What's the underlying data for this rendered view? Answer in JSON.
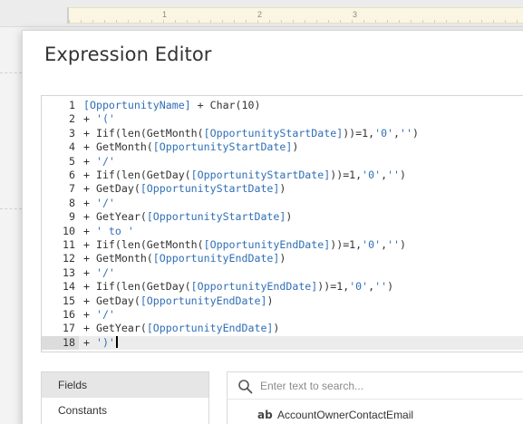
{
  "ruler": {
    "marks": [
      "1",
      "2",
      "3"
    ]
  },
  "dialog": {
    "title": "Expression Editor"
  },
  "editor": {
    "active_line": 18,
    "lines": [
      {
        "num": "1",
        "tokens": [
          {
            "t": "[OpportunityName]",
            "k": "field"
          },
          {
            "t": " + Char(10)",
            "k": "plain"
          }
        ]
      },
      {
        "num": "2",
        "tokens": [
          {
            "t": "+ ",
            "k": "plain"
          },
          {
            "t": "'('",
            "k": "string"
          }
        ]
      },
      {
        "num": "3",
        "tokens": [
          {
            "t": "+ Iif(len(GetMonth(",
            "k": "plain"
          },
          {
            "t": "[OpportunityStartDate]",
            "k": "field"
          },
          {
            "t": "))=1,",
            "k": "plain"
          },
          {
            "t": "'0'",
            "k": "string"
          },
          {
            "t": ",",
            "k": "plain"
          },
          {
            "t": "''",
            "k": "string"
          },
          {
            "t": ")",
            "k": "plain"
          }
        ]
      },
      {
        "num": "4",
        "tokens": [
          {
            "t": "+ GetMonth(",
            "k": "plain"
          },
          {
            "t": "[OpportunityStartDate]",
            "k": "field"
          },
          {
            "t": ")",
            "k": "plain"
          }
        ]
      },
      {
        "num": "5",
        "tokens": [
          {
            "t": "+ ",
            "k": "plain"
          },
          {
            "t": "'/'",
            "k": "string"
          }
        ]
      },
      {
        "num": "6",
        "tokens": [
          {
            "t": "+ Iif(len(GetDay(",
            "k": "plain"
          },
          {
            "t": "[OpportunityStartDate]",
            "k": "field"
          },
          {
            "t": "))=1,",
            "k": "plain"
          },
          {
            "t": "'0'",
            "k": "string"
          },
          {
            "t": ",",
            "k": "plain"
          },
          {
            "t": "''",
            "k": "string"
          },
          {
            "t": ")",
            "k": "plain"
          }
        ]
      },
      {
        "num": "7",
        "tokens": [
          {
            "t": "+ GetDay(",
            "k": "plain"
          },
          {
            "t": "[OpportunityStartDate]",
            "k": "field"
          },
          {
            "t": ")",
            "k": "plain"
          }
        ]
      },
      {
        "num": "8",
        "tokens": [
          {
            "t": "+ ",
            "k": "plain"
          },
          {
            "t": "'/'",
            "k": "string"
          }
        ]
      },
      {
        "num": "9",
        "tokens": [
          {
            "t": "+ GetYear(",
            "k": "plain"
          },
          {
            "t": "[OpportunityStartDate]",
            "k": "field"
          },
          {
            "t": ")",
            "k": "plain"
          }
        ]
      },
      {
        "num": "10",
        "tokens": [
          {
            "t": "+ ",
            "k": "plain"
          },
          {
            "t": "' to '",
            "k": "string"
          }
        ]
      },
      {
        "num": "11",
        "tokens": [
          {
            "t": "+ Iif(len(GetMonth(",
            "k": "plain"
          },
          {
            "t": "[OpportunityEndDate]",
            "k": "field"
          },
          {
            "t": "))=1,",
            "k": "plain"
          },
          {
            "t": "'0'",
            "k": "string"
          },
          {
            "t": ",",
            "k": "plain"
          },
          {
            "t": "''",
            "k": "string"
          },
          {
            "t": ")",
            "k": "plain"
          }
        ]
      },
      {
        "num": "12",
        "tokens": [
          {
            "t": "+ GetMonth(",
            "k": "plain"
          },
          {
            "t": "[OpportunityEndDate]",
            "k": "field"
          },
          {
            "t": ")",
            "k": "plain"
          }
        ]
      },
      {
        "num": "13",
        "tokens": [
          {
            "t": "+ ",
            "k": "plain"
          },
          {
            "t": "'/'",
            "k": "string"
          }
        ]
      },
      {
        "num": "14",
        "tokens": [
          {
            "t": "+ Iif(len(GetDay(",
            "k": "plain"
          },
          {
            "t": "[OpportunityEndDate]",
            "k": "field"
          },
          {
            "t": "))=1,",
            "k": "plain"
          },
          {
            "t": "'0'",
            "k": "string"
          },
          {
            "t": ",",
            "k": "plain"
          },
          {
            "t": "''",
            "k": "string"
          },
          {
            "t": ")",
            "k": "plain"
          }
        ]
      },
      {
        "num": "15",
        "tokens": [
          {
            "t": "+ GetDay(",
            "k": "plain"
          },
          {
            "t": "[OpportunityEndDate]",
            "k": "field"
          },
          {
            "t": ")",
            "k": "plain"
          }
        ]
      },
      {
        "num": "16",
        "tokens": [
          {
            "t": "+ ",
            "k": "plain"
          },
          {
            "t": "'/'",
            "k": "string"
          }
        ]
      },
      {
        "num": "17",
        "tokens": [
          {
            "t": "+ GetYear(",
            "k": "plain"
          },
          {
            "t": "[OpportunityEndDate]",
            "k": "field"
          },
          {
            "t": ")",
            "k": "plain"
          }
        ]
      },
      {
        "num": "18",
        "tokens": [
          {
            "t": "+ ",
            "k": "plain"
          },
          {
            "t": "')'",
            "k": "string"
          }
        ]
      }
    ]
  },
  "categories": {
    "items": [
      {
        "label": "Fields",
        "selected": true
      },
      {
        "label": "Constants",
        "selected": false
      }
    ]
  },
  "fields": {
    "search_placeholder": "Enter text to search...",
    "items": [
      {
        "type": "ab",
        "name": "AccountOwnerContactEmail"
      }
    ]
  },
  "colors": {
    "field_token": "#2f6fb5",
    "string_token": "#2f6fb5",
    "active_line_bg": "#ececec",
    "selected_category_bg": "#e6e6e6"
  }
}
